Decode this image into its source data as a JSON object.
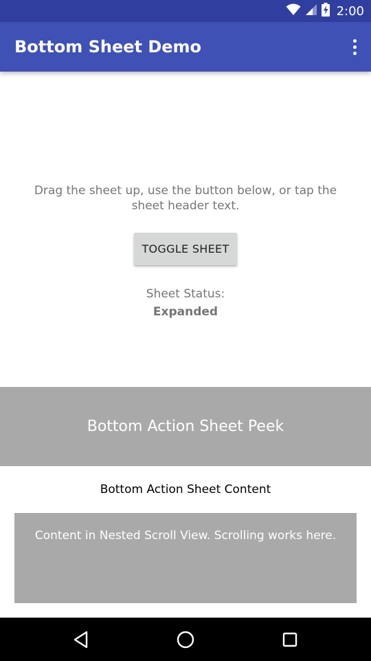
{
  "status_bar": {
    "time": "2:00",
    "icons": [
      "wifi-icon",
      "cell-signal-icon",
      "battery-charging-icon"
    ]
  },
  "app_bar": {
    "title": "Bottom Sheet Demo",
    "overflow_icon": "more-vert-icon"
  },
  "main": {
    "instructions": "Drag the sheet up, use the button below, or tap the sheet header text.",
    "toggle_button_label": "TOGGLE SHEET",
    "status_label": "Sheet Status:",
    "status_value": "Expanded"
  },
  "bottom_sheet": {
    "peek_text": "Bottom Action Sheet Peek",
    "content_title": "Bottom Action Sheet Content",
    "nested_scroll_text": "Content in Nested Scroll View. Scrolling works here."
  },
  "nav_bar": {
    "icons": [
      "back-icon",
      "home-icon",
      "recents-icon"
    ]
  },
  "colors": {
    "primary": "#3f51b5",
    "primary_dark": "#303f9f",
    "sheet_gray": "#a9a9a9",
    "button_gray": "#d6d7d7",
    "text_secondary": "#757575"
  }
}
